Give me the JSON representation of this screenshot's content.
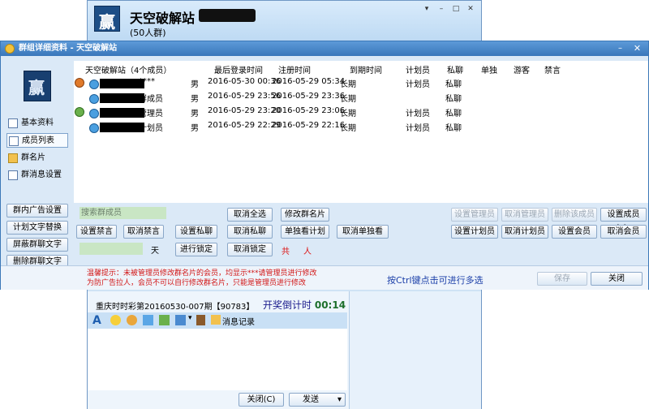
{
  "bg_window": {
    "title": "天空破解站",
    "member_count": "(50人群)",
    "lottery_text": "重庆时时彩第20160530-007期【90783】",
    "countdown_label": "开奖倒计时",
    "countdown_time": "00:14",
    "msg_log_label": "消息记录",
    "close_label": "关闭(C)",
    "send_label": "发送"
  },
  "dialog": {
    "title": "群组详细资料 - 天空破解站"
  },
  "nav": [
    {
      "label": "基本资料"
    },
    {
      "label": "成员列表"
    },
    {
      "label": "群名片"
    },
    {
      "label": "群消息设置"
    }
  ],
  "left_buttons": [
    {
      "label": "群内广告设置"
    },
    {
      "label": "计划文字替换"
    },
    {
      "label": "屏蔽群聊文字"
    },
    {
      "label": "删除群聊文字"
    }
  ],
  "table": {
    "headers": [
      "天空破解站（4个成员）",
      "最后登录时间",
      "注册时间",
      "到期时间",
      "计划员",
      "私聊",
      "单独",
      "游客",
      "禁言"
    ],
    "rows": [
      {
        "name": "****",
        "gender": "男",
        "last_login": "2016-05-30 00:36",
        "registered": "2016-05-29 05:34",
        "expires": "长期",
        "planner": "计划员",
        "private": "私聊"
      },
      {
        "name": "群成员",
        "gender": "男",
        "last_login": "2016-05-29 23:56",
        "registered": "2016-05-29 23:36",
        "expires": "长期",
        "planner": "",
        "private": "私聊"
      },
      {
        "name": "管理员",
        "gender": "男",
        "last_login": "2016-05-29 23:20",
        "registered": "2016-05-29 23:06",
        "expires": "长期",
        "planner": "计划员",
        "private": "私聊"
      },
      {
        "name": "计划员",
        "gender": "男",
        "last_login": "2016-05-29 22:29",
        "registered": "2016-05-29 22:16",
        "expires": "长期",
        "planner": "计划员",
        "private": "私聊"
      }
    ]
  },
  "search_placeholder": "搜索群成员",
  "actions": {
    "select_all_cancel": "取消全选",
    "edit_card": "修改群名片",
    "set_mute": "设置禁言",
    "cancel_mute": "取消禁言",
    "set_private": "设置私聊",
    "cancel_private": "取消私聊",
    "solo_plan": "单独看计划",
    "cancel_solo": "取消单独看",
    "do_lock": "进行锁定",
    "cancel_lock": "取消锁定",
    "days_label": "天",
    "total_label": "共",
    "people_label": "人",
    "set_admin": "设置管理员",
    "cancel_admin": "取消管理员",
    "delete_member": "删除该成员",
    "set_member": "设置成员>>",
    "set_planner": "设置计划员",
    "cancel_planner": "取消计划员",
    "set_vip": "设置会员",
    "cancel_vip": "取消会员"
  },
  "footer": {
    "warning_line1": "温馨提示：未被管理员修改群名片的会员，均显示***请管理员进行修改",
    "warning_line2": "为防广告拉人，会员不可以自行修改群名片，只能是管理员进行修改",
    "hint": "按Ctrl键点击可进行多选",
    "save_label": "保存",
    "close_label": "关闭"
  }
}
